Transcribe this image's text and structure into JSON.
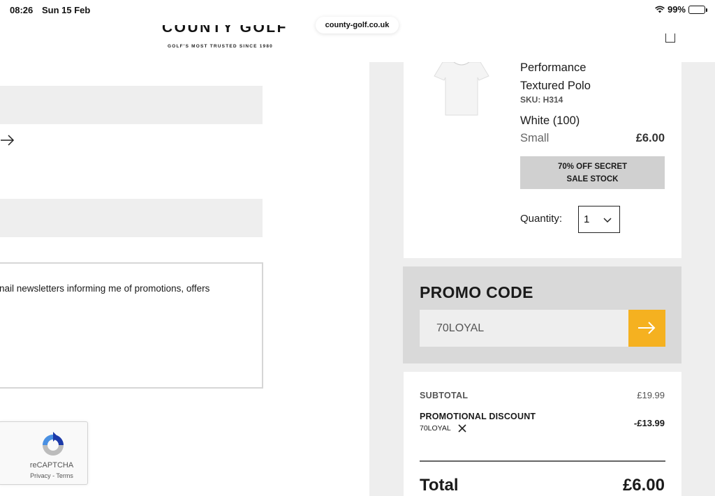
{
  "status_bar": {
    "time": "08:26",
    "date": "Sun 15 Feb",
    "battery": "99%",
    "wifi_icon": "wifi-icon",
    "battery_icon": "battery-icon"
  },
  "browser": {
    "url": "county-golf.co.uk"
  },
  "header": {
    "logo_text": "COUNTY GOLF",
    "tagline": "GOLF'S MOST TRUSTED SINCE 1980",
    "bag_icon": "shopping-bag-icon"
  },
  "form": {
    "arrow_icon": "arrow-right-icon",
    "newsletter_text": "nail newsletters informing me of promotions, offers"
  },
  "recaptcha": {
    "label": "reCAPTCHA",
    "links": "Privacy - Terms"
  },
  "basket_item": {
    "name_line1": "Performance",
    "name_line2": "Textured Polo",
    "sku": "SKU: H314",
    "colour": "White (100)",
    "size": "Small",
    "price": "£6.00",
    "badge_line1": "70% OFF SECRET",
    "badge_line2": "SALE STOCK",
    "quantity_label": "Quantity:",
    "quantity_value": "1"
  },
  "promo": {
    "title": "PROMO CODE",
    "input_value": "70LOYAL",
    "submit_icon": "arrow-right-icon",
    "accent_color": "#f5b120"
  },
  "totals": {
    "subtotal_label": "SUBTOTAL",
    "subtotal_value": "£19.99",
    "discount_label": "PROMOTIONAL DISCOUNT",
    "discount_code": "70LOYAL",
    "discount_value": "-£13.99",
    "total_label": "Total",
    "total_value": "£6.00"
  }
}
